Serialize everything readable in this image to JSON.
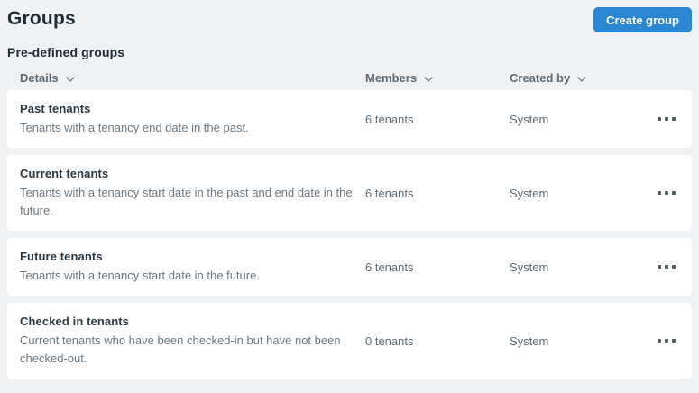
{
  "page": {
    "title": "Groups",
    "section_title": "Pre-defined groups",
    "create_button_label": "Create group"
  },
  "table": {
    "columns": [
      {
        "label": "Details",
        "sortable": true
      },
      {
        "label": "Members",
        "sortable": true
      },
      {
        "label": "Created by",
        "sortable": true
      }
    ],
    "rows": [
      {
        "name": "Past tenants",
        "description": "Tenants with a tenancy end date in the past.",
        "members": "6 tenants",
        "created_by": "System"
      },
      {
        "name": "Current tenants",
        "description": "Tenants with a tenancy start date in the past and end date in the future.",
        "members": "6 tenants",
        "created_by": "System"
      },
      {
        "name": "Future tenants",
        "description": "Tenants with a tenancy start date in the future.",
        "members": "6 tenants",
        "created_by": "System"
      },
      {
        "name": "Checked in tenants",
        "description": "Current tenants who have been checked-in but have not been checked-out.",
        "members": "0 tenants",
        "created_by": "System"
      }
    ]
  },
  "icons": {
    "sort_chevron": "chevron-down",
    "row_menu": "horizontal-ellipsis"
  },
  "colors": {
    "accent": "#2b87d3",
    "background": "#eff1f2",
    "card": "#ffffff",
    "heading": "#1f2d38",
    "muted_text": "#6b7882",
    "header_text": "#5d6a74"
  }
}
